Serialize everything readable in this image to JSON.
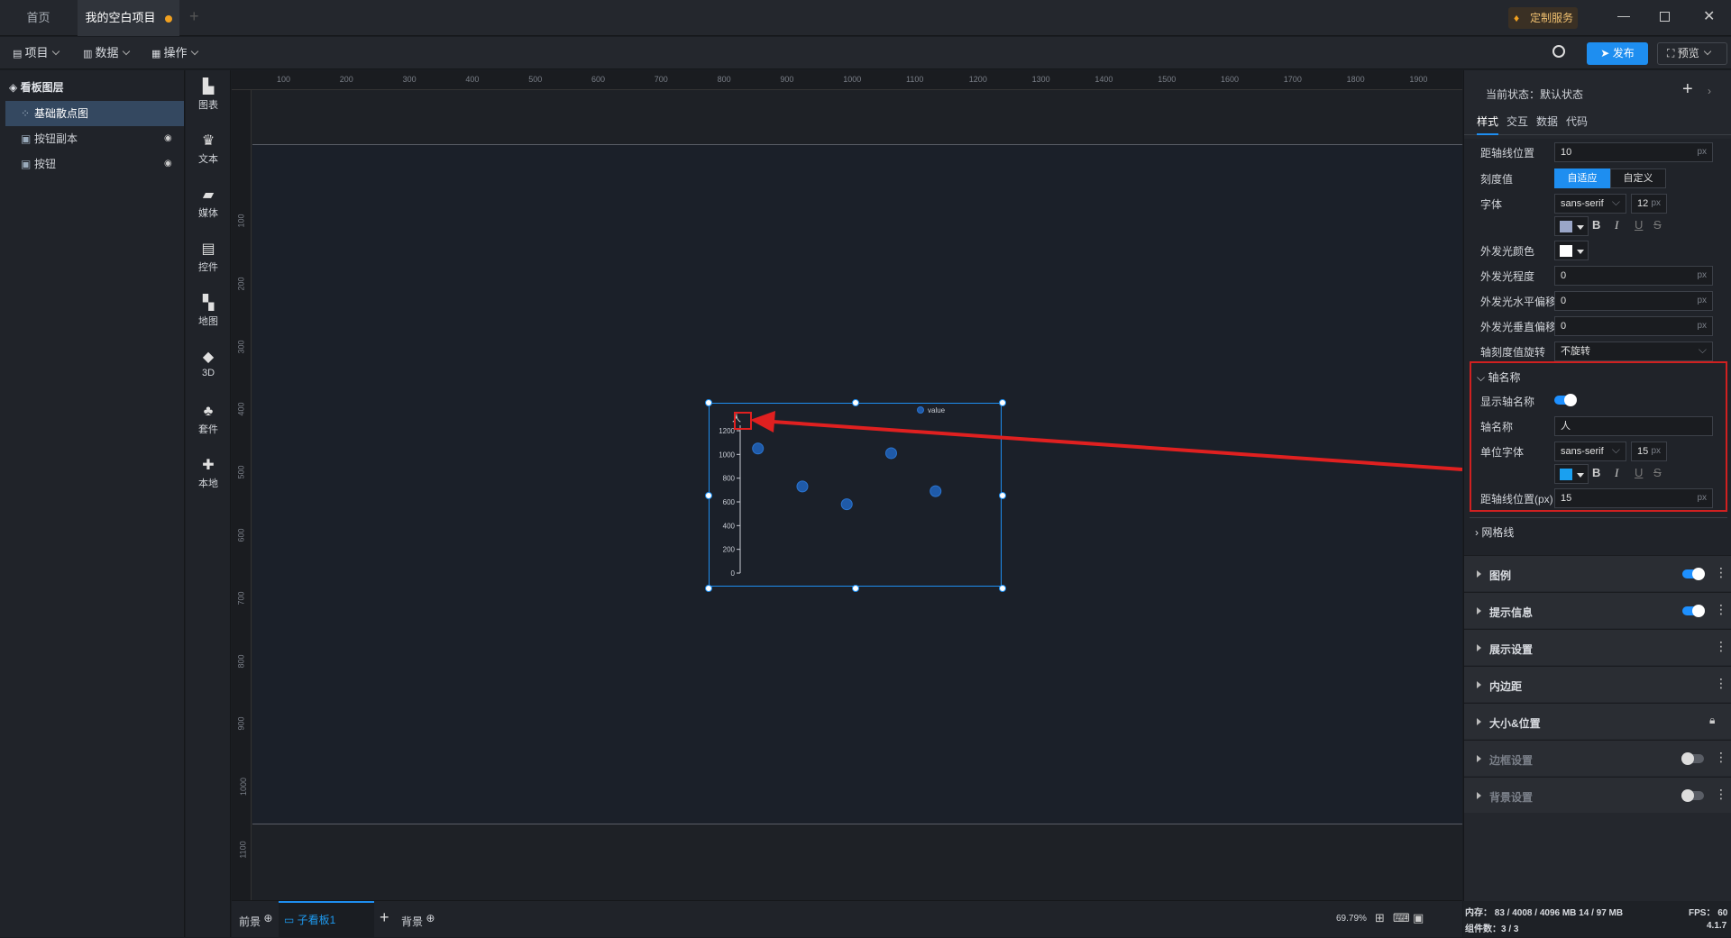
{
  "tabs": {
    "home": "首页",
    "project": "我的空白项目"
  },
  "title_right": {
    "custom_service": "定制服务"
  },
  "toolbar": {
    "project": "项目",
    "data": "数据",
    "operate": "操作",
    "publish": "发布",
    "preview": "预览"
  },
  "layers": {
    "title": "看板图层",
    "items": [
      {
        "label": "基础散点图"
      },
      {
        "label": "按钮副本"
      },
      {
        "label": "按钮"
      }
    ]
  },
  "sidebar": {
    "items": [
      "图表",
      "文本",
      "媒体",
      "控件",
      "地图",
      "3D",
      "套件",
      "本地"
    ]
  },
  "ruler": {
    "h": [
      "100",
      "200",
      "300",
      "400",
      "500",
      "600",
      "700",
      "800",
      "900",
      "1000",
      "1100",
      "1200",
      "1300",
      "1400",
      "1500",
      "1600",
      "1700",
      "1800",
      "1900"
    ],
    "v": [
      "100",
      "200",
      "300",
      "400",
      "500",
      "600",
      "700",
      "800",
      "900",
      "1000",
      "1100"
    ]
  },
  "chart_data": {
    "type": "scatter",
    "title": "",
    "ylabel": "人",
    "ylim": [
      0,
      1200
    ],
    "yticks": [
      "1200",
      "1000",
      "800",
      "600",
      "400",
      "200",
      "0"
    ],
    "legend": {
      "label": "value",
      "position": "top-right"
    },
    "series": [
      {
        "name": "value",
        "points": [
          [
            1,
            1050
          ],
          [
            2,
            730
          ],
          [
            3,
            580
          ],
          [
            4,
            1010
          ],
          [
            5,
            690
          ]
        ]
      }
    ]
  },
  "bottom": {
    "foreground": "前景",
    "subboard": "子看板1",
    "background": "背景",
    "zoom": "69.79%"
  },
  "right": {
    "state": "当前状态：默认状态",
    "tabs": [
      "样式",
      "交互",
      "数据",
      "代码"
    ],
    "axis_line_distance": {
      "label": "距轴线位置",
      "value": "10",
      "unit": "px"
    },
    "tick_value": {
      "label": "刻度值",
      "options": [
        "自适应",
        "自定义"
      ]
    },
    "font": {
      "label": "字体",
      "family": "sans-serif",
      "size": "12",
      "unit": "px",
      "color": "#9aa6c8"
    },
    "glow_color": {
      "label": "外发光颜色",
      "color": "#ffffff"
    },
    "glow_degree": {
      "label": "外发光程度",
      "value": "0",
      "unit": "px"
    },
    "glow_h": {
      "label": "外发光水平偏移",
      "value": "0",
      "unit": "px"
    },
    "glow_v": {
      "label": "外发光垂直偏移",
      "value": "0",
      "unit": "px"
    },
    "tick_rotate": {
      "label": "轴刻度值旋转",
      "value": "不旋转"
    },
    "axis_name_section": {
      "title": "轴名称"
    },
    "show_axis_name": {
      "label": "显示轴名称"
    },
    "axis_name": {
      "label": "轴名称",
      "value": "人"
    },
    "unit_font": {
      "label": "单位字体",
      "family": "sans-serif",
      "size": "15",
      "unit": "px",
      "color": "#1aa0f0"
    },
    "axis_name_distance": {
      "label": "距轴线位置(px)",
      "value": "15",
      "unit": "px"
    },
    "grid_section": {
      "title": "网格线"
    },
    "sections": [
      "图例",
      "提示信息",
      "展示设置",
      "内边距",
      "大小&位置",
      "边框设置",
      "背景设置"
    ]
  },
  "status": {
    "memory": "内存： 83 / 4008 / 4096 MB  14 / 97 MB",
    "fps": "FPS： 60",
    "components": "组件数：3 / 3",
    "version": "4.1.7"
  }
}
